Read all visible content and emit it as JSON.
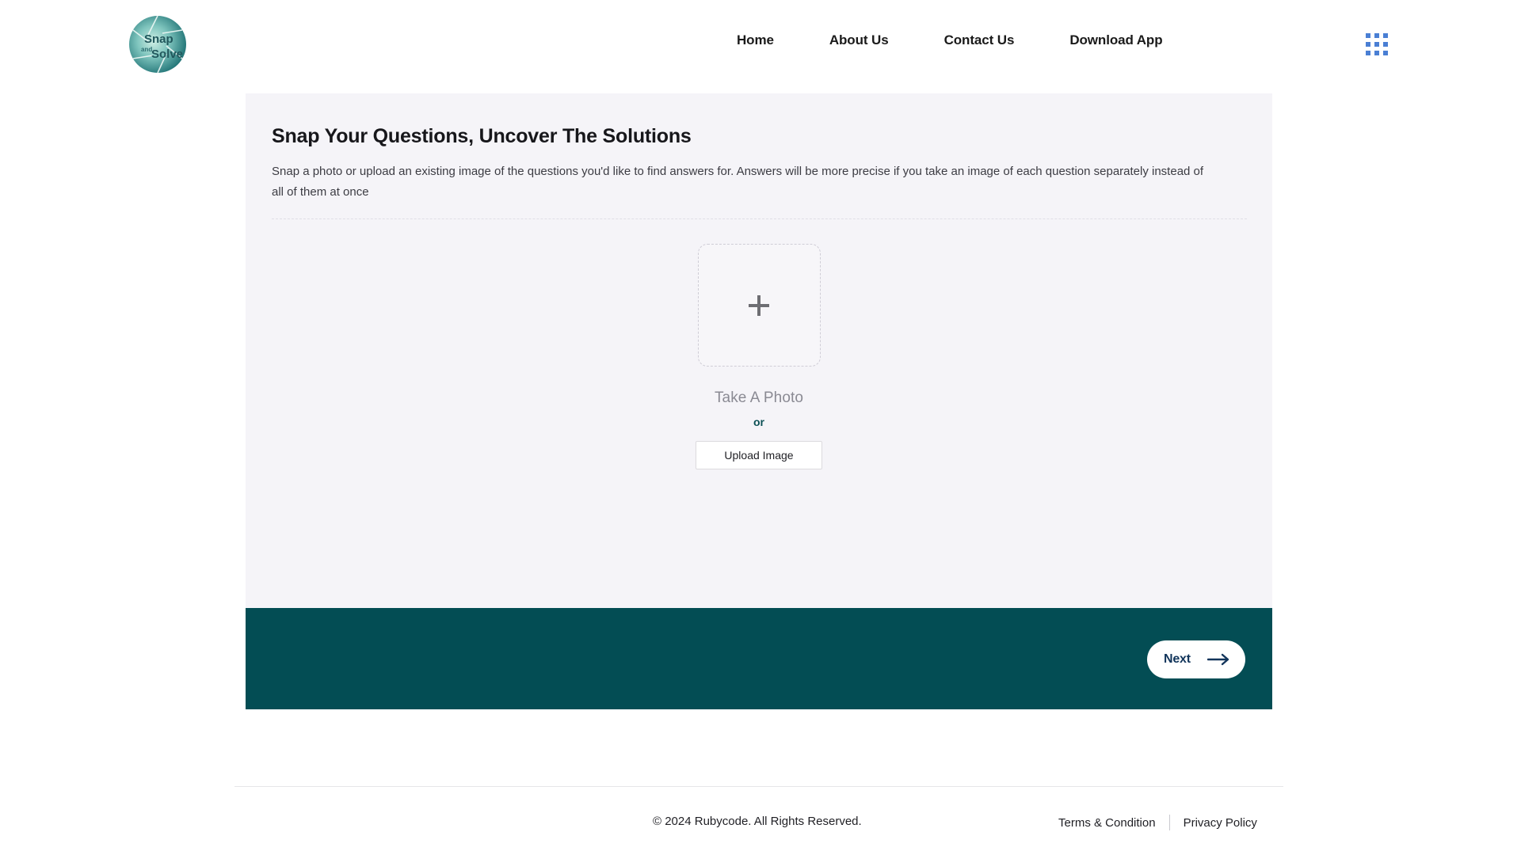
{
  "header": {
    "logo": {
      "icon": "snap-and-solve-aperture-logo",
      "line1": "Snap",
      "line2": "and",
      "line3": "Solve"
    },
    "nav": [
      {
        "label": "Home"
      },
      {
        "label": "About Us"
      },
      {
        "label": "Contact Us"
      },
      {
        "label": "Download App"
      }
    ],
    "apps_icon": "grid-apps-icon",
    "apps_icon_color": "#4a7fd4"
  },
  "card": {
    "title": "Snap Your Questions, Uncover The Solutions",
    "description": "Snap a photo or upload an existing image of the questions you'd like to find answers for. Answers will be more precise if you take an image of each question separately instead of all of them at once",
    "background": "#f5f4f8",
    "upload": {
      "dropzone_icon": "plus-icon",
      "take_photo_label": "Take A Photo",
      "or_label": "or",
      "upload_button_label": "Upload Image"
    }
  },
  "action_bar": {
    "background": "#034d54",
    "next_label": "Next",
    "next_icon": "arrow-right-icon",
    "next_text_color": "#12355b"
  },
  "footer": {
    "copyright": "© 2024 Rubycode. All Rights Reserved.",
    "links": [
      {
        "label": "Terms & Condition"
      },
      {
        "label": "Privacy Policy"
      }
    ]
  }
}
